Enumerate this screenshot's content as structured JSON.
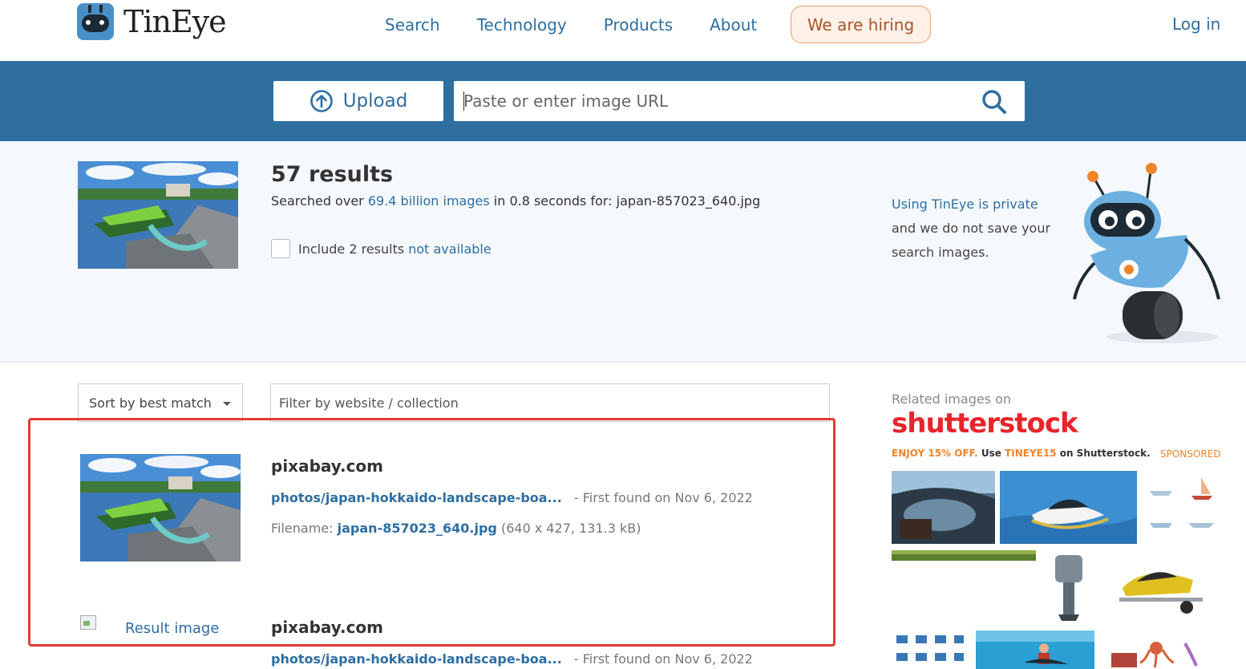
{
  "brand": {
    "name": "TinEye"
  },
  "nav": {
    "items": [
      {
        "label": "Search"
      },
      {
        "label": "Technology"
      },
      {
        "label": "Products"
      },
      {
        "label": "About"
      }
    ],
    "hiring_label": "We are hiring",
    "login_label": "Log in"
  },
  "search": {
    "upload_label": "Upload",
    "url_placeholder": "Paste or enter image URL"
  },
  "summary": {
    "count_label": "57 results",
    "searched_prefix": "Searched over",
    "searched_highlight": "69.4 billion images",
    "searched_suffix": "in 0.8 seconds for:",
    "query_filename": "japan-857023_640.jpg",
    "include_text": "Include 2 results",
    "include_link": "not available",
    "privacy_link": "Using TinEye is private",
    "privacy_text": "and we do not save your search images."
  },
  "controls": {
    "sort_label": "Sort by best match",
    "filter_placeholder": "Filter by website / collection"
  },
  "results": [
    {
      "domain": "pixabay.com",
      "path": "photos/japan-hokkaido-landscape-boa...",
      "first_found": "- First found on Nov 6, 2022",
      "filename_label": "Filename:",
      "filename": "japan-857023_640.jpg",
      "file_meta": "(640 x 427, 131.3 kB)"
    },
    {
      "domain": "pixabay.com",
      "image_alt": "Result image",
      "path": "photos/japan-hokkaido-landscape-boa...",
      "first_found": "- First found on Nov 6, 2022"
    }
  ],
  "sidebar": {
    "related_label": "Related images on",
    "logo_text": "shutterstock",
    "promo_orange_1": "ENJOY 15% OFF.",
    "promo_text_1": "Use",
    "promo_orange_2": "TINEYE15",
    "promo_text_2": "on Shutterstock.",
    "sponsored_label": "SPONSORED"
  },
  "colors": {
    "accent": "#2d6ea3",
    "band": "#2f6fa0",
    "hiring_bg": "#fdf1e7",
    "highlight": "#e53935",
    "shutterstock_red": "#e8242b",
    "promo_orange": "#f0842a"
  }
}
